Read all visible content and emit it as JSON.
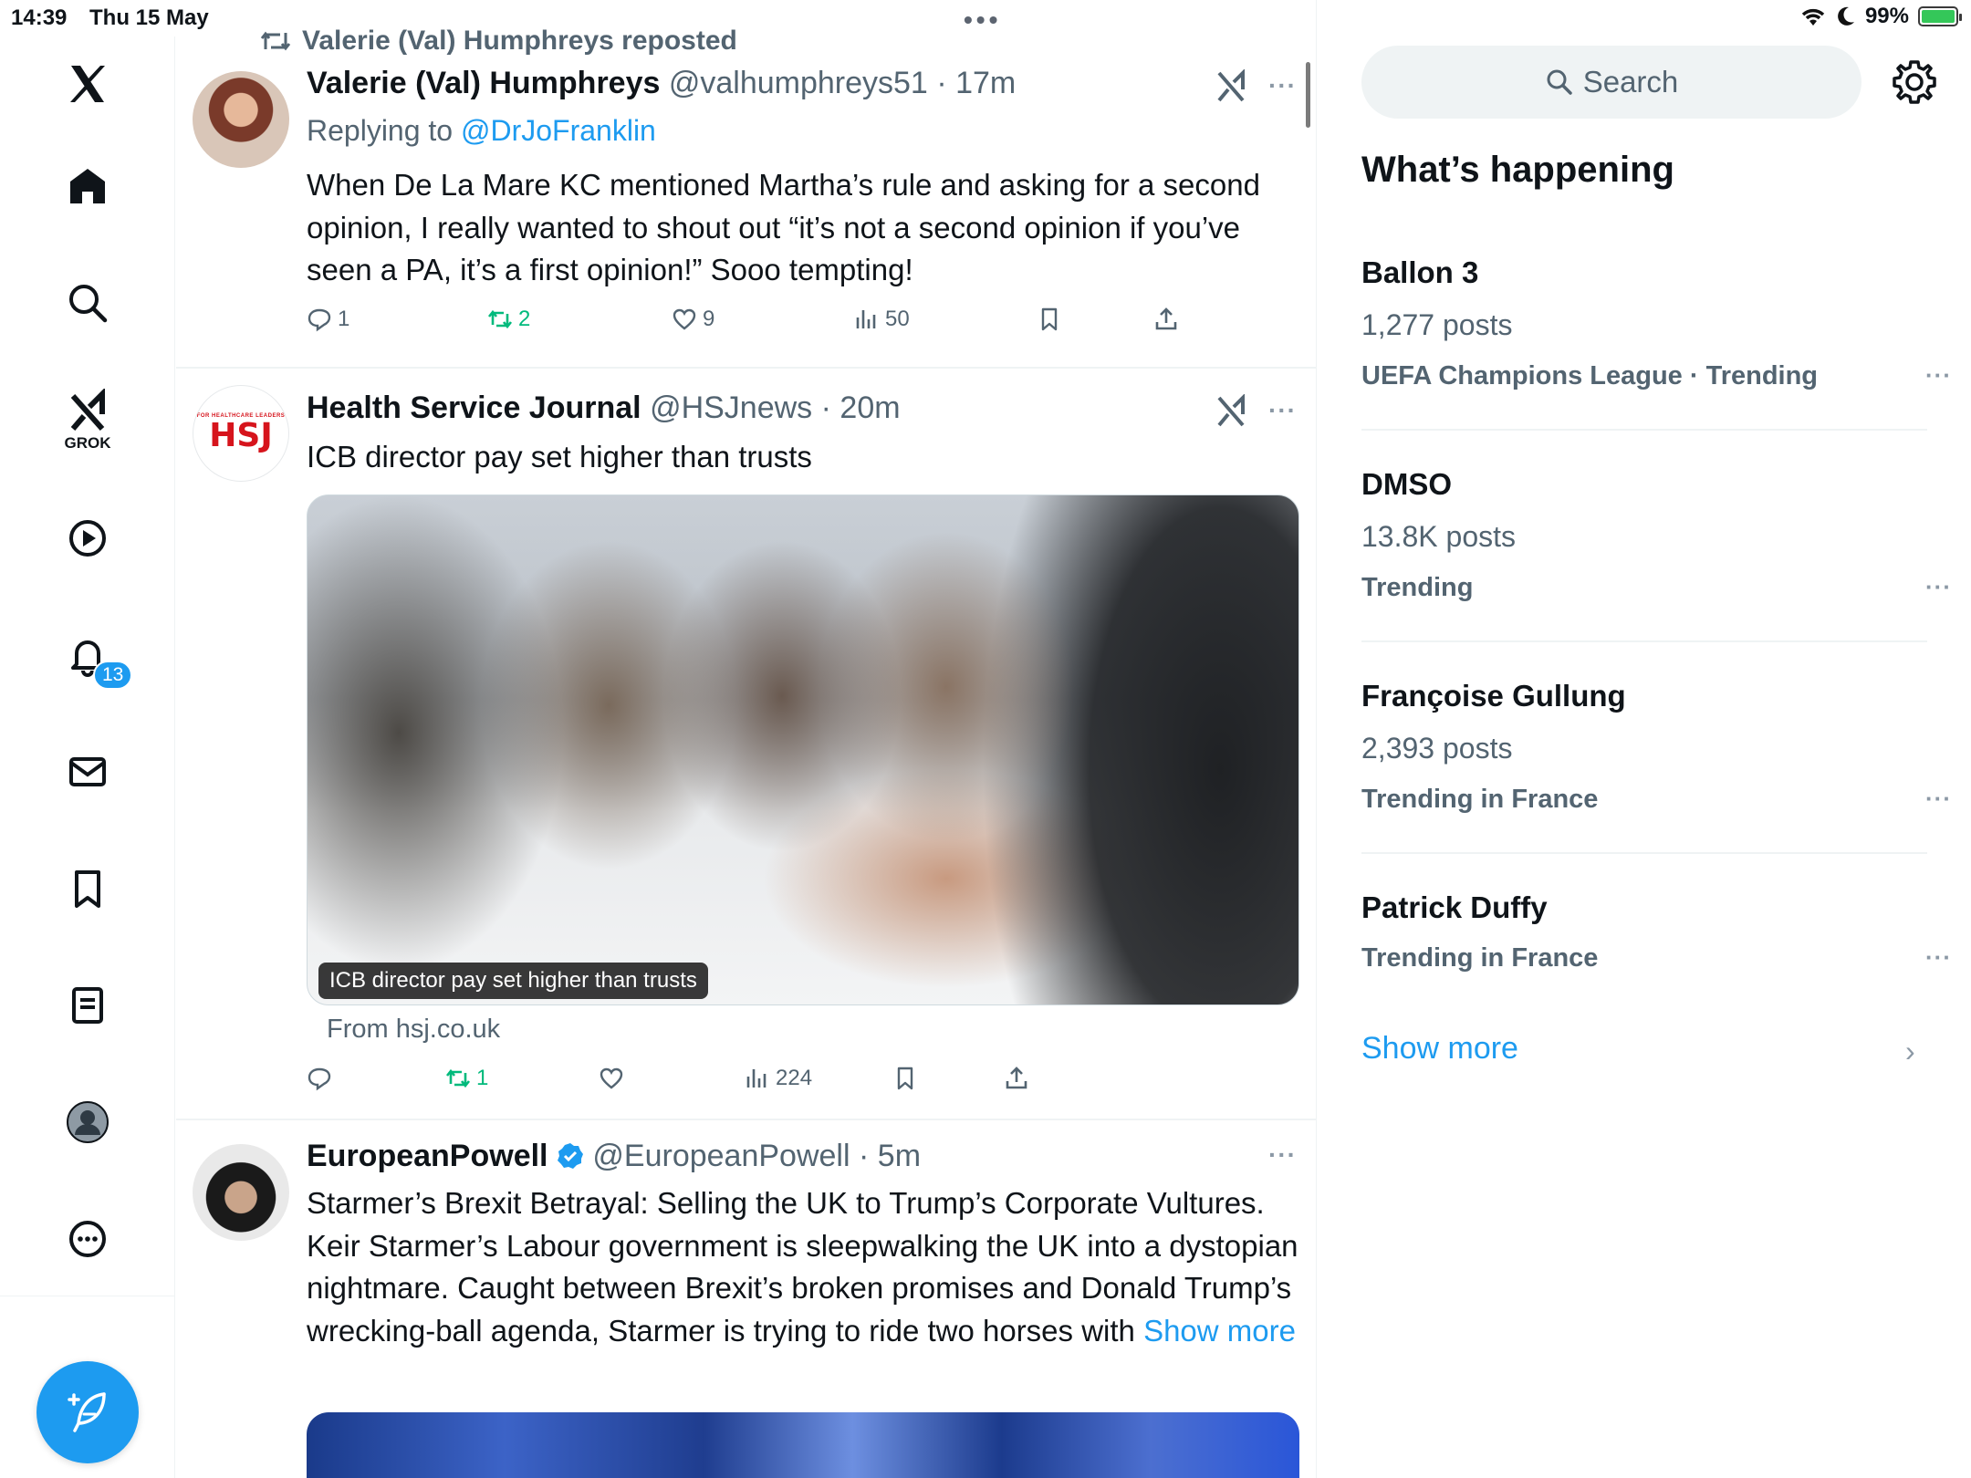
{
  "status_bar": {
    "time": "14:39",
    "date": "Thu 15 May",
    "battery": "99%",
    "battery_level": 0.99
  },
  "sidebar": {
    "grok_label": "GROK",
    "notifications_badge": "13",
    "items": [
      "x-logo",
      "home",
      "explore",
      "grok",
      "video",
      "notifications",
      "messages",
      "bookmarks",
      "lists",
      "profile",
      "more"
    ]
  },
  "feed": {
    "tweets": [
      {
        "repost_header": "Valerie (Val) Humphreys reposted",
        "name": "Valerie (Val) Humphreys",
        "handle": "@valhumphreys51",
        "sep": "·",
        "time": "17m",
        "replying_label": "Replying to",
        "replying_to": "@DrJoFranklin",
        "text": "When De La Mare KC mentioned Martha’s rule and asking for a second opinion, I really wanted to shout out “it’s not a second opinion if you’ve seen a PA, it’s a first opinion!” Sooo tempting!",
        "replies": "1",
        "reposts": "2",
        "likes": "9",
        "views": "50"
      },
      {
        "name": "Health Service Journal",
        "handle": "@HSJnews",
        "sep": "·",
        "time": "20m",
        "text": "ICB director pay set higher than trusts",
        "avatar_text": "HSJ",
        "avatar_small": "FOR HEALTHCARE LEADERS",
        "media_caption": "ICB director pay set higher than trusts",
        "from": "From hsj.co.uk",
        "replies": "",
        "reposts": "1",
        "likes": "",
        "views": "224"
      },
      {
        "name": "EuropeanPowell",
        "handle": "@EuropeanPowell",
        "sep": "·",
        "time": "5m",
        "verified": true,
        "text": "Starmer’s Brexit Betrayal: Selling the UK to Trump’s Corporate Vultures. Keir Starmer’s Labour government is sleepwalking the UK into a dystopian nightmare. Caught between Brexit’s broken promises and Donald Trump’s wrecking-ball agenda, Starmer is trying to ride two horses with",
        "show_more": "Show more"
      }
    ]
  },
  "right": {
    "search_placeholder": "Search",
    "section_title": "What’s happening",
    "trends": [
      {
        "name": "Ballon 3",
        "count": "1,277 posts",
        "context": "UEFA Champions League · Trending"
      },
      {
        "name": "DMSO",
        "count": "13.8K posts",
        "context": "Trending"
      },
      {
        "name": "Françoise Gullung",
        "count": "2,393 posts",
        "context": "Trending in France"
      },
      {
        "name": "Patrick Duffy",
        "count": "",
        "context": "Trending in France"
      }
    ],
    "show_more": "Show more",
    "more_label": "···"
  },
  "colors": {
    "accent": "#1d9bf0",
    "repost_green": "#00ba7c",
    "secondary_text": "#536471"
  }
}
